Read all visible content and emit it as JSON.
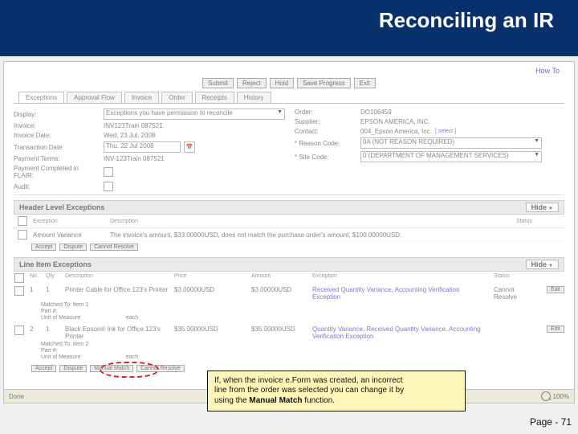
{
  "title": "Reconciling an IR",
  "howto": "How To",
  "buttons": {
    "submit": "Submit",
    "reject": "Reject",
    "hold": "Hold",
    "save_progress": "Save Progress",
    "exit": "Exit"
  },
  "tabs": [
    "Exceptions",
    "Approval Flow",
    "Invoice",
    "Order",
    "Receipts",
    "History"
  ],
  "form": {
    "display_label": "Display:",
    "display_value": "Exceptions you have permission to reconcile",
    "invoice_label": "Invoice:",
    "invoice_value": "INV123Train 087521",
    "invoice_date_label": "Invoice Date:",
    "invoice_date_value": "Wed, 23 Jul, 2008",
    "transaction_date_label": "Transaction Date:",
    "transaction_date_value": "Thu, 22 Jul 2008",
    "payment_terms_label": "Payment Terms:",
    "payment_terms_value": "INV-123Train 087521",
    "payment_completed_label": "Payment Completed in FLAIR:",
    "audit_label": "Audit:",
    "order_label": "Order:",
    "order_value": "DO106459",
    "supplier_label": "Supplier:",
    "supplier_value": "EPSON AMERICA, INC.",
    "contact_label": "Contact:",
    "contact_value": "004_Epson America, Inc.",
    "select_op": "[ select ]",
    "reason_label": "* Reason Code:",
    "reason_value": "0A (NOT REASON REQUIRED)",
    "site_label": "* Site Code:",
    "site_value": "0 (DEPARTMENT OF MANAGEMENT SERVICES)"
  },
  "headerSection": {
    "title": "Header Level Exceptions",
    "hide": "Hide",
    "cols": {
      "exception": "Exception",
      "description": "Description",
      "status": "Status"
    },
    "row": {
      "exception": "Amount Variance",
      "description": "The invoice's amount, $33.00000USD, does not match the purchase order's amount, $100.00000USD."
    },
    "actions": {
      "accept": "Accept",
      "dispute": "Dispute",
      "cannot": "Cannot Resolve"
    }
  },
  "lineSection": {
    "title": "Line Item Exceptions",
    "hide": "Hide",
    "cols": {
      "no": "No.",
      "qty": "Qty",
      "description": "Description",
      "price": "Price",
      "amount": "Amount",
      "exception": "Exception",
      "status": "Status"
    },
    "row1": {
      "no": "1",
      "qty": "1",
      "desc": "Printer Cable for Office 123's Printer",
      "price": "$3.00000USD",
      "amount": "$3.00000USD",
      "exception": "Received Quantity Variance, Accounting Verification Exception",
      "status": "Cannot Resolve",
      "edit": "Edit",
      "matched": "Matched To: Item 1",
      "part": "Part #:",
      "uom_label": "Unit of Measure",
      "uom_value": "each"
    },
    "row2": {
      "no": "2",
      "qty": "1",
      "desc": "Black Epson® Ink for Office 123's Printer",
      "price": "$35.00000USD",
      "amount": "$35.00000USD",
      "exception": "Quantity Variance, Received Quantity Variance, Accounting Verification Exception",
      "edit": "Edit",
      "matched": "Matched To: Item 2",
      "part": "Part #:",
      "uom_label": "Unit of Measure",
      "uom_value": "each"
    },
    "actions": {
      "accept": "Accept",
      "dispute": "Dispute",
      "manual": "Manual Match",
      "cannot": "Cannot Resolve"
    }
  },
  "statusbar": {
    "done": "Done",
    "zoom": "100%"
  },
  "callout_l1": "If, when the invoice e.Form was created, an incorrect",
  "callout_l2": "line from the order was selected you can change it by",
  "callout_l3": "using the ",
  "callout_l3b": "Manual Match",
  "callout_l3c": " function.",
  "page": "Page - 71"
}
